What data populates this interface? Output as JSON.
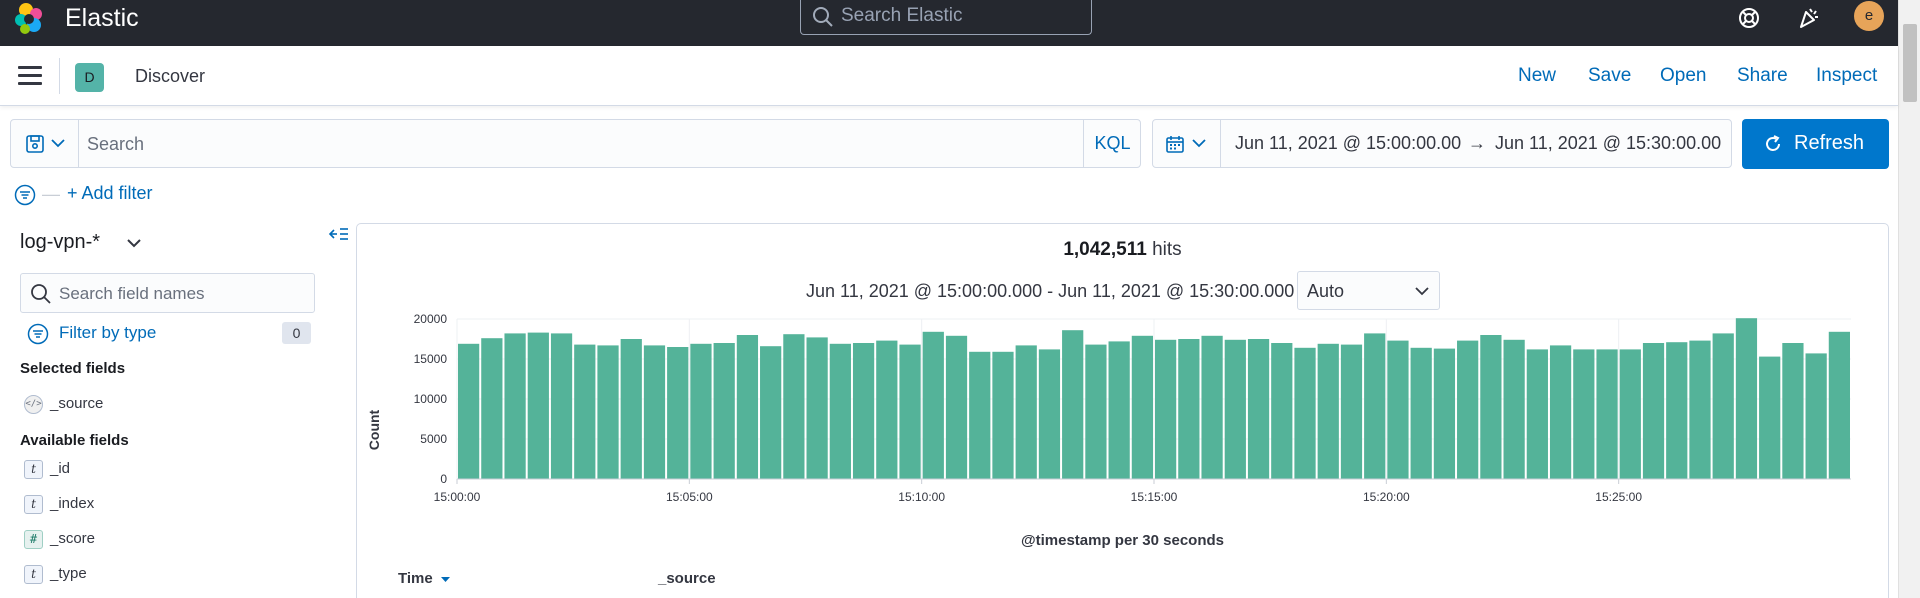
{
  "header": {
    "brand": "Elastic",
    "search_placeholder": "Search Elastic",
    "user_initial": "e"
  },
  "app_bar": {
    "app_initial": "D",
    "title": "Discover",
    "links": [
      "New",
      "Save",
      "Open",
      "Share",
      "Inspect"
    ]
  },
  "query": {
    "placeholder": "Search",
    "language": "KQL"
  },
  "date_range": {
    "start": "Jun 11, 2021 @ 15:00:00.00",
    "arrow": "→",
    "end": "Jun 11, 2021 @ 15:30:00.00"
  },
  "refresh_label": "Refresh",
  "filter": {
    "dash": "—",
    "add_label": "+ Add filter"
  },
  "sidebar": {
    "index_pattern": "log-vpn-*",
    "field_search_placeholder": "Search field names",
    "filter_by_type": "Filter by type",
    "type_count": "0",
    "selected_label": "Selected fields",
    "selected_fields": [
      {
        "type": "source",
        "icon": "</>",
        "name": "_source"
      }
    ],
    "available_label": "Available fields",
    "available_fields": [
      {
        "type": "string",
        "icon": "t",
        "name": "_id"
      },
      {
        "type": "string",
        "icon": "t",
        "name": "_index"
      },
      {
        "type": "number",
        "icon": "#",
        "name": "_score"
      },
      {
        "type": "string",
        "icon": "t",
        "name": "_type"
      }
    ]
  },
  "main": {
    "hits_count": "1,042,511",
    "hits_label": "hits",
    "time_range": "Jun 11, 2021 @ 15:00:00.000 - Jun 11, 2021 @ 15:30:00.000",
    "interval": "Auto",
    "table_columns": [
      "Time",
      "_source"
    ]
  },
  "chart_data": {
    "type": "bar",
    "color": "#54b399",
    "ylabel": "Count",
    "xlabel": "@timestamp per 30 seconds",
    "ylim": [
      0,
      20000
    ],
    "y_ticks": [
      0,
      5000,
      10000,
      15000,
      20000
    ],
    "x_ticks": [
      "15:00:00",
      "15:05:00",
      "15:10:00",
      "15:15:00",
      "15:20:00",
      "15:25:00"
    ],
    "bucket_seconds": 30,
    "values": [
      16900,
      17600,
      18200,
      18300,
      18200,
      16800,
      16700,
      17500,
      16700,
      16500,
      16900,
      17000,
      18000,
      16600,
      18100,
      17700,
      16900,
      17000,
      17300,
      16800,
      18400,
      17900,
      15900,
      15900,
      16700,
      16200,
      18600,
      16800,
      17200,
      17900,
      17400,
      17500,
      17900,
      17400,
      17500,
      17000,
      16400,
      16900,
      16800,
      18200,
      17300,
      16400,
      16300,
      17300,
      18000,
      17400,
      16200,
      16700,
      16200,
      16200,
      16200,
      17000,
      17100,
      17300,
      18200,
      20100,
      15300,
      17000,
      15700,
      18400
    ]
  }
}
